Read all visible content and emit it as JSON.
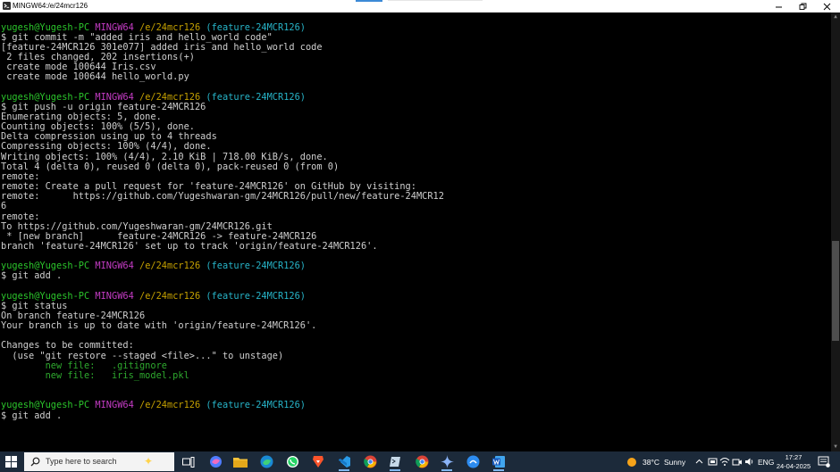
{
  "window": {
    "title": "MINGW64:/e/24mcr126"
  },
  "terminal": {
    "lines": [
      {
        "y": 0,
        "segs": [
          {
            "t": "",
            "c": ""
          }
        ]
      },
      {
        "y": 1,
        "segs": [
          {
            "t": "yugesh@Yugesh-PC ",
            "c": "g"
          },
          {
            "t": "MINGW64 ",
            "c": "m"
          },
          {
            "t": "/e/24mcr126 ",
            "c": "y"
          },
          {
            "t": "(feature-24MCR126)",
            "c": "c"
          }
        ]
      },
      {
        "y": 2,
        "segs": [
          {
            "t": "$ git commit -m \"added iris and hello_world code\"",
            "c": ""
          }
        ]
      },
      {
        "y": 3,
        "segs": [
          {
            "t": "[feature-24MCR126 301e077] added iris and hello_world code",
            "c": ""
          }
        ]
      },
      {
        "y": 4,
        "segs": [
          {
            "t": " 2 files changed, 202 insertions(+)",
            "c": ""
          }
        ]
      },
      {
        "y": 5,
        "segs": [
          {
            "t": " create mode 100644 Iris.csv",
            "c": ""
          }
        ]
      },
      {
        "y": 6,
        "segs": [
          {
            "t": " create mode 100644 hello_world.py",
            "c": ""
          }
        ]
      },
      {
        "y": 7,
        "segs": [
          {
            "t": "",
            "c": ""
          }
        ]
      },
      {
        "y": 8,
        "segs": [
          {
            "t": "yugesh@Yugesh-PC ",
            "c": "g"
          },
          {
            "t": "MINGW64 ",
            "c": "m"
          },
          {
            "t": "/e/24mcr126 ",
            "c": "y"
          },
          {
            "t": "(feature-24MCR126)",
            "c": "c"
          }
        ]
      },
      {
        "y": 9,
        "segs": [
          {
            "t": "$ git push -u origin feature-24MCR126",
            "c": ""
          }
        ]
      },
      {
        "y": 10,
        "segs": [
          {
            "t": "Enumerating objects: 5, done.",
            "c": ""
          }
        ]
      },
      {
        "y": 11,
        "segs": [
          {
            "t": "Counting objects: 100% (5/5), done.",
            "c": ""
          }
        ]
      },
      {
        "y": 12,
        "segs": [
          {
            "t": "Delta compression using up to 4 threads",
            "c": ""
          }
        ]
      },
      {
        "y": 13,
        "segs": [
          {
            "t": "Compressing objects: 100% (4/4), done.",
            "c": ""
          }
        ]
      },
      {
        "y": 14,
        "segs": [
          {
            "t": "Writing objects: 100% (4/4), 2.10 KiB | 718.00 KiB/s, done.",
            "c": ""
          }
        ]
      },
      {
        "y": 15,
        "segs": [
          {
            "t": "Total 4 (delta 0), reused 0 (delta 0), pack-reused 0 (from 0)",
            "c": ""
          }
        ]
      },
      {
        "y": 16,
        "segs": [
          {
            "t": "remote:",
            "c": ""
          }
        ]
      },
      {
        "y": 17,
        "segs": [
          {
            "t": "remote: Create a pull request for 'feature-24MCR126' on GitHub by visiting:",
            "c": ""
          }
        ]
      },
      {
        "y": 18,
        "segs": [
          {
            "t": "remote:      https://github.com/Yugeshwaran-gm/24MCR126/pull/new/feature-24MCR12",
            "c": ""
          }
        ]
      },
      {
        "y": 19,
        "segs": [
          {
            "t": "6",
            "c": ""
          }
        ]
      },
      {
        "y": 20,
        "segs": [
          {
            "t": "remote:",
            "c": ""
          }
        ]
      },
      {
        "y": 21,
        "segs": [
          {
            "t": "To https://github.com/Yugeshwaran-gm/24MCR126.git",
            "c": ""
          }
        ]
      },
      {
        "y": 22,
        "segs": [
          {
            "t": " * [new branch]      feature-24MCR126 -> feature-24MCR126",
            "c": ""
          }
        ]
      },
      {
        "y": 23,
        "segs": [
          {
            "t": "branch 'feature-24MCR126' set up to track 'origin/feature-24MCR126'.",
            "c": ""
          }
        ]
      },
      {
        "y": 24,
        "segs": [
          {
            "t": "",
            "c": ""
          }
        ]
      },
      {
        "y": 25,
        "segs": [
          {
            "t": "yugesh@Yugesh-PC ",
            "c": "g"
          },
          {
            "t": "MINGW64 ",
            "c": "m"
          },
          {
            "t": "/e/24mcr126 ",
            "c": "y"
          },
          {
            "t": "(feature-24MCR126)",
            "c": "c"
          }
        ]
      },
      {
        "y": 26,
        "segs": [
          {
            "t": "$ git add .",
            "c": ""
          }
        ]
      },
      {
        "y": 27,
        "segs": [
          {
            "t": "",
            "c": ""
          }
        ]
      },
      {
        "y": 28,
        "segs": [
          {
            "t": "yugesh@Yugesh-PC ",
            "c": "g"
          },
          {
            "t": "MINGW64 ",
            "c": "m"
          },
          {
            "t": "/e/24mcr126 ",
            "c": "y"
          },
          {
            "t": "(feature-24MCR126)",
            "c": "c"
          }
        ]
      },
      {
        "y": 29,
        "segs": [
          {
            "t": "$ git status",
            "c": ""
          }
        ]
      },
      {
        "y": 30,
        "segs": [
          {
            "t": "On branch feature-24MCR126",
            "c": ""
          }
        ]
      },
      {
        "y": 31,
        "segs": [
          {
            "t": "Your branch is up to date with 'origin/feature-24MCR126'.",
            "c": ""
          }
        ]
      },
      {
        "y": 32,
        "segs": [
          {
            "t": "",
            "c": ""
          }
        ]
      },
      {
        "y": 33,
        "segs": [
          {
            "t": "Changes to be committed:",
            "c": ""
          }
        ]
      },
      {
        "y": 34,
        "segs": [
          {
            "t": "  (use \"git restore --staged <file>...\" to unstage)",
            "c": ""
          }
        ]
      },
      {
        "y": 35,
        "segs": [
          {
            "t": "        new file:   .gitignore",
            "c": "gn"
          }
        ]
      },
      {
        "y": 36,
        "segs": [
          {
            "t": "        new file:   iris_model.pkl",
            "c": "gn"
          }
        ]
      },
      {
        "y": 37,
        "segs": [
          {
            "t": "",
            "c": ""
          }
        ]
      },
      {
        "y": 38,
        "segs": [
          {
            "t": "",
            "c": ""
          }
        ]
      },
      {
        "y": 39,
        "segs": [
          {
            "t": "yugesh@Yugesh-PC ",
            "c": "g"
          },
          {
            "t": "MINGW64 ",
            "c": "m"
          },
          {
            "t": "/e/24mcr126 ",
            "c": "y"
          },
          {
            "t": "(feature-24MCR126)",
            "c": "c"
          }
        ]
      },
      {
        "y": 40,
        "segs": [
          {
            "t": "$ git add .",
            "c": ""
          }
        ]
      }
    ]
  },
  "taskbar": {
    "search_placeholder": "Type here to search",
    "weather_temp": "38°C",
    "weather_desc": "Sunny",
    "language": "ENG",
    "time": "17:27",
    "date": "24-04-2025",
    "apps": [
      "task-view-icon",
      "copilot-icon",
      "file-explorer-icon",
      "edge-icon",
      "whatsapp-icon",
      "brave-icon",
      "vscode-icon",
      "chrome-icon",
      "git-bash-icon",
      "chrome-profile-icon",
      "gemini-icon",
      "store-icon",
      "word-icon"
    ]
  }
}
